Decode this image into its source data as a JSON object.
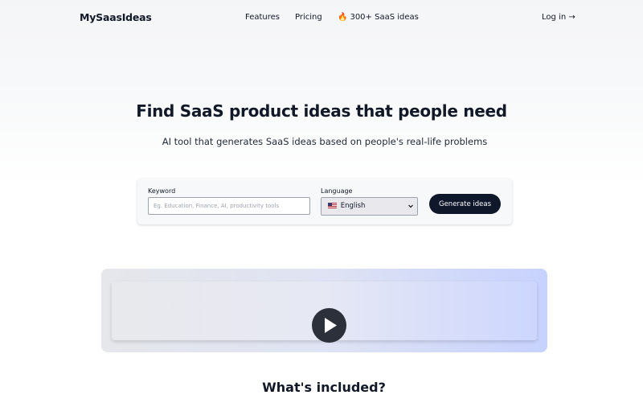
{
  "nav": {
    "logo": "MySaasIdeas",
    "features": "Features",
    "pricing": "Pricing",
    "ideas": "300+ SaaS ideas",
    "login": "Log in →"
  },
  "hero": {
    "title": "Find SaaS product ideas that people need",
    "subtitle": "AI tool that generates SaaS ideas based on people's real-life problems"
  },
  "form": {
    "keyword_label": "Keyword",
    "keyword_placeholder": "Eg. Education, Finance, AI, productivity tools",
    "keyword_value": "",
    "language_label": "Language",
    "language_value": "English",
    "generate_label": "Generate ideas"
  },
  "icons": {
    "fire": "fire-icon",
    "flag": "us-flag-icon",
    "play": "play-icon"
  },
  "section": {
    "included_title": "What's included?"
  },
  "colors": {
    "button": "#0f172a",
    "play": "#2b303b",
    "accent": "#c7d2fe"
  }
}
